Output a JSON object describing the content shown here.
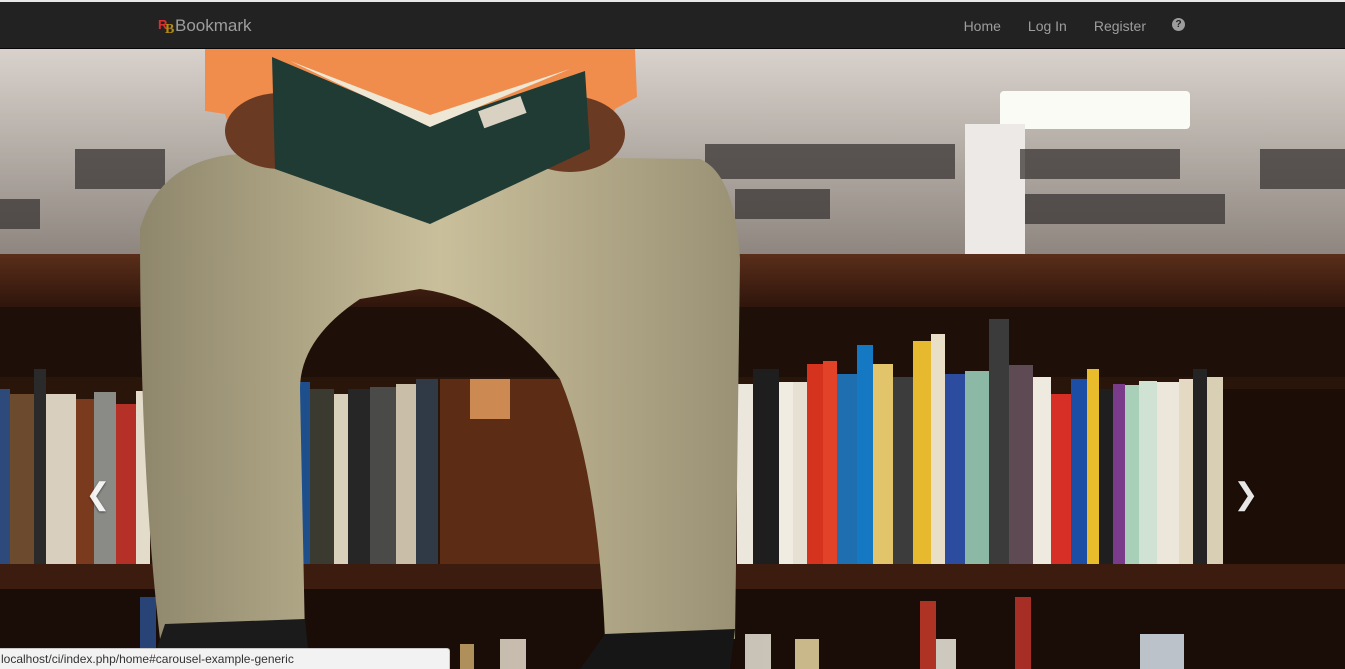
{
  "navbar": {
    "brand_text": "Bookmark",
    "links": [
      "Home",
      "Log In",
      "Register"
    ],
    "help_icon": "question-circle-icon"
  },
  "carousel": {
    "prev_icon": "chevron-left-icon",
    "next_icon": "chevron-right-icon",
    "prev_glyph": "❮",
    "next_glyph": "❯"
  },
  "status_url": "localhost/ci/index.php/home#carousel-example-generic",
  "colors": {
    "navbar_bg": "#222222",
    "nav_link": "#9d9d9d",
    "logo_red": "#d9302f",
    "logo_gold": "#b38b12"
  }
}
